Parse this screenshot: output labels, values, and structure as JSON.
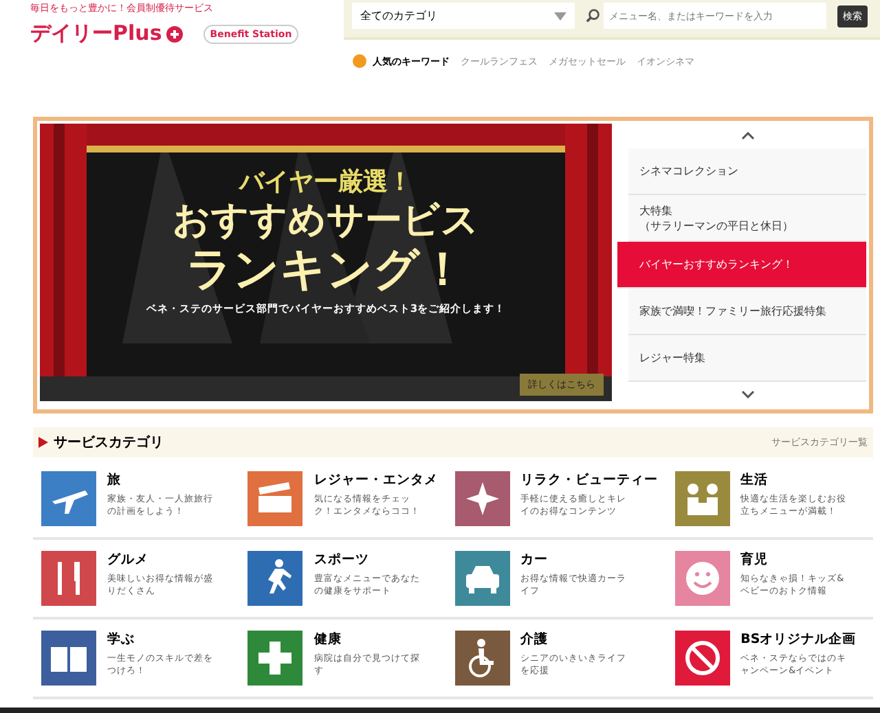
{
  "header": {
    "tagline": "毎日をもっと豊かに！会員制優待サービス",
    "logo": "デイリーPlus",
    "partner_logo": "Benefit Station",
    "category_select": "全てのカテゴリ",
    "search": {
      "placeholder": "メニュー名、またはキーワードを入力"
    },
    "search_button": "検索"
  },
  "keywords": {
    "label": "人気のキーワード",
    "items": [
      "クールランフェス",
      "メガセットセール",
      "イオンシネマ"
    ]
  },
  "banner": {
    "kicker": "バイヤー厳選！",
    "headline_1": "おすすめサービス",
    "headline_2": "ランキング！",
    "caption": "ベネ・ステのサービス部門でバイヤーおすすめベスト3をご紹介します！",
    "button": "詳しくはこちら"
  },
  "feature_list": [
    {
      "label": "シネマコレクション",
      "selected": false
    },
    {
      "label": "大特集",
      "sub": "（サラリーマンの平日と休日）",
      "selected": false
    },
    {
      "label": "バイヤーおすすめランキング！",
      "selected": true
    },
    {
      "label": "家族で満喫！ファミリー旅行応援特集",
      "selected": false
    },
    {
      "label": "レジャー特集",
      "selected": false
    }
  ],
  "categories": {
    "title": "サービスカテゴリ",
    "link": "サービスカテゴリ一覧",
    "items": [
      {
        "name": "旅",
        "desc": "家族・友人・一人旅旅行の計画をしよう！",
        "color": "#3d7fc4"
      },
      {
        "name": "レジャー・エンタメ",
        "desc": "気になる情報をチェック！エンタメならココ！",
        "color": "#e0703f"
      },
      {
        "name": "リラク・ビューティー",
        "desc": "手軽に使える癒しとキレイのお得なコンテンツ",
        "color": "#a85a6e"
      },
      {
        "name": "生活",
        "desc": "快適な生活を楽しむお役立ちメニューが満載！",
        "color": "#9a8a3e"
      },
      {
        "name": "グルメ",
        "desc": "美味しいお得な情報が盛りだくさん",
        "color": "#d0484c"
      },
      {
        "name": "スポーツ",
        "desc": "豊富なメニューであなたの健康をサポート",
        "color": "#2f6db3"
      },
      {
        "name": "カー",
        "desc": "お得な情報で快適カーライフ",
        "color": "#3f8a9a"
      },
      {
        "name": "育児",
        "desc": "知らなきゃ損！キッズ&ベビーのおトク情報",
        "color": "#e585a0"
      },
      {
        "name": "学ぶ",
        "desc": "一生モノのスキルで差をつけろ！",
        "color": "#3e5f9e"
      },
      {
        "name": "健康",
        "desc": "病院は自分で見つけて探す",
        "color": "#2e8a3a"
      },
      {
        "name": "介護",
        "desc": "シニアのいきいきライフを応援",
        "color": "#7a5a3e"
      },
      {
        "name": "BSオリジナル企画",
        "desc": "ベネ・ステならではのキャンペーン&イベント",
        "color": "#e01a3a"
      }
    ]
  }
}
